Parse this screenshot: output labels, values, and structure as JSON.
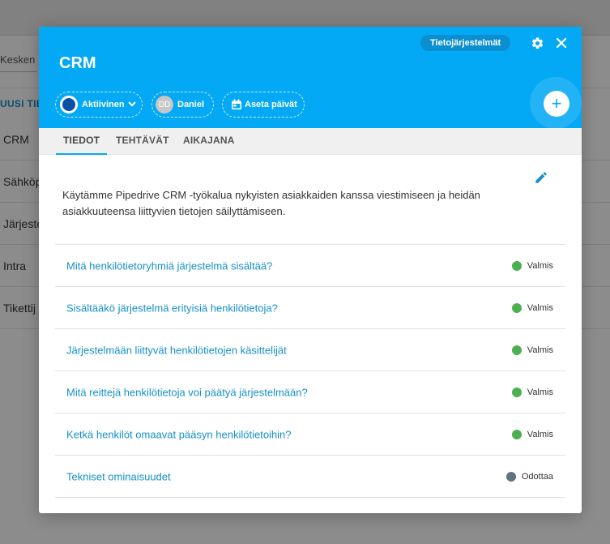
{
  "background": {
    "search_label": "Kesken",
    "new_link": "UUSI TIE",
    "rows": [
      "CRM",
      "Sähköp",
      "Järjeste",
      "Intra",
      "Tikettij"
    ]
  },
  "modal": {
    "badge": "Tietojärjestelmät",
    "title": "CRM",
    "chips": {
      "status": "Aktiivinen",
      "user_initials": "DD",
      "user": "Daniel",
      "date": "Aseta päivät"
    },
    "tabs": [
      {
        "label": "TIEDOT",
        "active": true
      },
      {
        "label": "TEHTÄVÄT",
        "active": false
      },
      {
        "label": "AIKAJANA",
        "active": false
      }
    ],
    "description": "Käytämme Pipedrive CRM -työkalua nykyisten asiakkaiden kanssa viestimiseen ja heidän asiakkuuteensa liittyvien tietojen säilyttämiseen.",
    "questions": [
      {
        "text": "Mitä henkilötietoryhmiä järjestelmä sisältää?",
        "status": "Valmis",
        "status_color": "#4caf50"
      },
      {
        "text": "Sisältääkö järjestelmä erityisiä henkilötietoja?",
        "status": "Valmis",
        "status_color": "#4caf50"
      },
      {
        "text": "Järjestelmään liittyvät henkilötietojen käsittelijät",
        "status": "Valmis",
        "status_color": "#4caf50"
      },
      {
        "text": "Mitä reittejä henkilötietoja voi päätyä järjestelmään?",
        "status": "Valmis",
        "status_color": "#4caf50"
      },
      {
        "text": "Ketkä henkilöt omaavat pääsyn henkilötietoihin?",
        "status": "Valmis",
        "status_color": "#4caf50"
      },
      {
        "text": "Tekniset ominaisuudet",
        "status": "Odottaa",
        "status_color": "#5f7481"
      }
    ]
  },
  "colors": {
    "header": "#03a9f4",
    "link": "#1690c8",
    "done": "#4caf50",
    "waiting": "#5f7481"
  },
  "icons": [
    "gear-icon",
    "close-icon",
    "chevron-down-icon",
    "calendar-icon",
    "plus-icon",
    "pencil-icon"
  ]
}
